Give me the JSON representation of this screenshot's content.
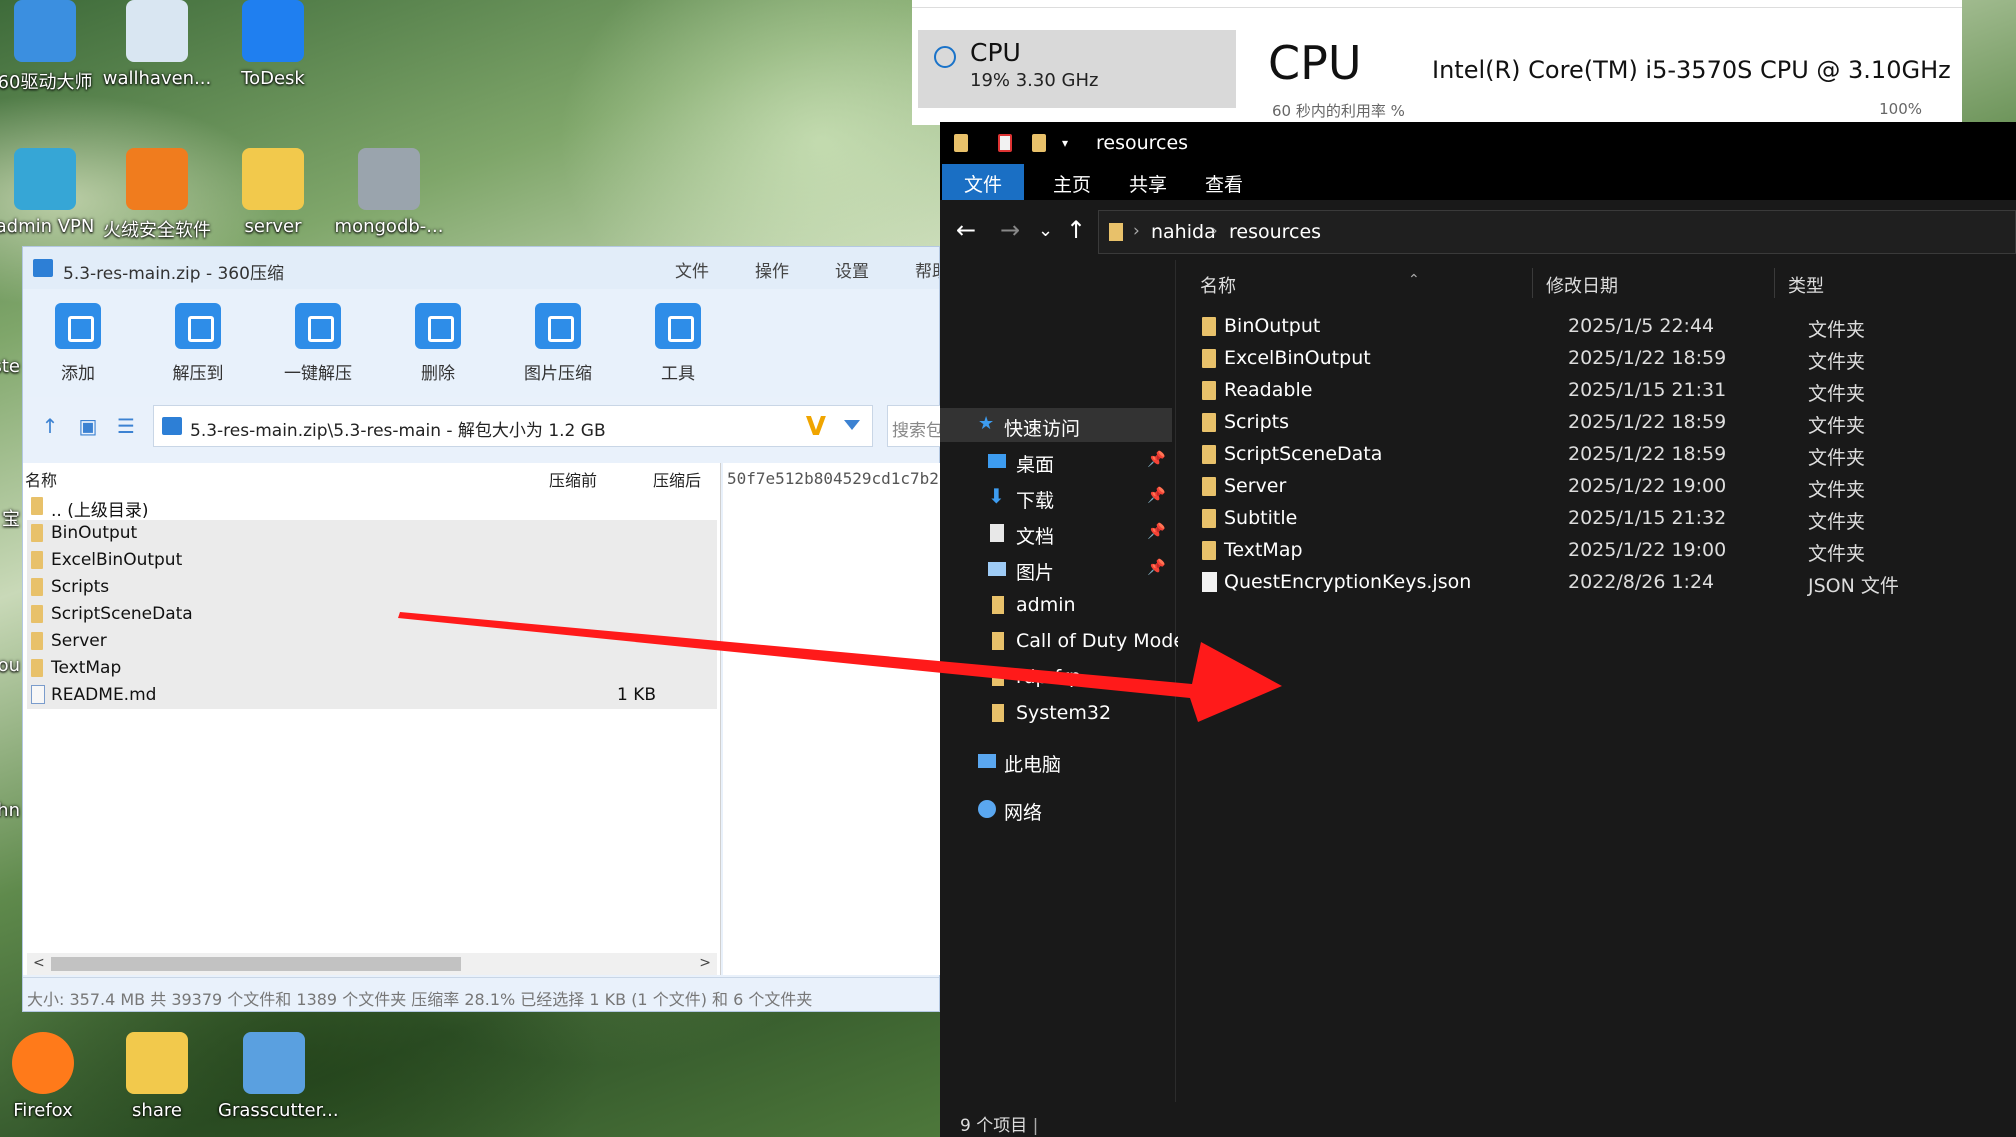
{
  "desktop": {
    "icons": [
      {
        "label": "60驱动大师",
        "color": "#3b8fe0"
      },
      {
        "label": "wallhaven...",
        "color": "#d9e6f2"
      },
      {
        "label": "ToDesk",
        "color": "#1f7ff0"
      },
      {
        "label": "admin VPN",
        "color": "#36a6d6"
      },
      {
        "label": "火绒安全软件",
        "color": "#f07c1e"
      },
      {
        "label": "server",
        "color": "#f2c94c"
      },
      {
        "label": "mongodb-...",
        "color": "#9aa4ad"
      },
      {
        "label": "Firefox",
        "color": "#ff7a1a"
      },
      {
        "label": "share",
        "color": "#f2c94c"
      },
      {
        "label": "Grasscutter...",
        "color": "#5aa0e0"
      }
    ],
    "edge_fragments": [
      "ste",
      "宝",
      "ou",
      "hn"
    ]
  },
  "taskmgr": {
    "cpu_item_label": "CPU",
    "cpu_item_sub": "19%  3.30 GHz",
    "title": "CPU",
    "model": "Intel(R) Core(TM) i5-3570S CPU @ 3.10GHz",
    "util_label": "60 秒内的利用率 %",
    "pct_label": "100%"
  },
  "zip": {
    "title": "5.3-res-main.zip - 360压缩",
    "menu": [
      "文件",
      "操作",
      "设置",
      "帮助"
    ],
    "tools": [
      {
        "label": "添加",
        "icon": "add-icon"
      },
      {
        "label": "解压到",
        "icon": "extract-to-icon"
      },
      {
        "label": "一键解压",
        "icon": "one-click-extract-icon"
      },
      {
        "label": "删除",
        "icon": "delete-icon"
      },
      {
        "label": "图片压缩",
        "icon": "image-compress-icon"
      },
      {
        "label": "工具",
        "icon": "tools-icon"
      }
    ],
    "address": "5.3-res-main.zip\\5.3-res-main - 解包大小为 1.2 GB",
    "search_placeholder": "搜索包",
    "columns": {
      "name": "名称",
      "before": "压缩前",
      "after": "压缩后"
    },
    "rows": [
      {
        "name": ".. (上级目录)",
        "size": "",
        "type": "folder"
      },
      {
        "name": "BinOutput",
        "size": "",
        "type": "folder"
      },
      {
        "name": "ExcelBinOutput",
        "size": "",
        "type": "folder"
      },
      {
        "name": "Scripts",
        "size": "",
        "type": "folder"
      },
      {
        "name": "ScriptSceneData",
        "size": "",
        "type": "folder"
      },
      {
        "name": "Server",
        "size": "",
        "type": "folder"
      },
      {
        "name": "TextMap",
        "size": "",
        "type": "folder"
      },
      {
        "name": "README.md",
        "size": "1 KB",
        "type": "file"
      }
    ],
    "hash": "50f7e512b804529cd1c7b2",
    "status": "大小: 357.4 MB 共 39379 个文件和 1389 个文件夹 压缩率 28.1% 已经选择 1 KB (1 个文件) 和 6 个文件夹"
  },
  "explorer": {
    "title": "resources",
    "tabs": [
      "文件",
      "主页",
      "共享",
      "查看"
    ],
    "breadcrumb": [
      "nahida",
      "resources"
    ],
    "nav": [
      {
        "label": "快速访问",
        "pinned": false,
        "icon": "star-icon"
      },
      {
        "label": "桌面",
        "pinned": true,
        "icon": "desktop-icon"
      },
      {
        "label": "下载",
        "pinned": true,
        "icon": "download-icon"
      },
      {
        "label": "文档",
        "pinned": true,
        "icon": "document-icon"
      },
      {
        "label": "图片",
        "pinned": true,
        "icon": "picture-icon"
      },
      {
        "label": "admin",
        "pinned": false,
        "icon": "folder-icon"
      },
      {
        "label": "Call of Duty Mode",
        "pinned": false,
        "icon": "folder-icon"
      },
      {
        "label": "rdp-frp",
        "pinned": false,
        "icon": "folder-icon"
      },
      {
        "label": "System32",
        "pinned": false,
        "icon": "folder-icon"
      },
      {
        "label": "此电脑",
        "pinned": false,
        "icon": "computer-icon"
      },
      {
        "label": "网络",
        "pinned": false,
        "icon": "network-icon"
      }
    ],
    "columns": {
      "name": "名称",
      "date": "修改日期",
      "type": "类型"
    },
    "rows": [
      {
        "name": "BinOutput",
        "date": "2025/1/5 22:44",
        "type": "文件夹",
        "kind": "folder"
      },
      {
        "name": "ExcelBinOutput",
        "date": "2025/1/22 18:59",
        "type": "文件夹",
        "kind": "folder"
      },
      {
        "name": "Readable",
        "date": "2025/1/15 21:31",
        "type": "文件夹",
        "kind": "folder"
      },
      {
        "name": "Scripts",
        "date": "2025/1/22 18:59",
        "type": "文件夹",
        "kind": "folder"
      },
      {
        "name": "ScriptSceneData",
        "date": "2025/1/22 18:59",
        "type": "文件夹",
        "kind": "folder"
      },
      {
        "name": "Server",
        "date": "2025/1/22 19:00",
        "type": "文件夹",
        "kind": "folder"
      },
      {
        "name": "Subtitle",
        "date": "2025/1/15 21:32",
        "type": "文件夹",
        "kind": "folder"
      },
      {
        "name": "TextMap",
        "date": "2025/1/22 19:00",
        "type": "文件夹",
        "kind": "folder"
      },
      {
        "name": "QuestEncryptionKeys.json",
        "date": "2022/8/26 1:24",
        "type": "JSON 文件",
        "kind": "file"
      }
    ],
    "status": "9 个项目"
  },
  "annotation_arrow_color": "#ff1a1a"
}
